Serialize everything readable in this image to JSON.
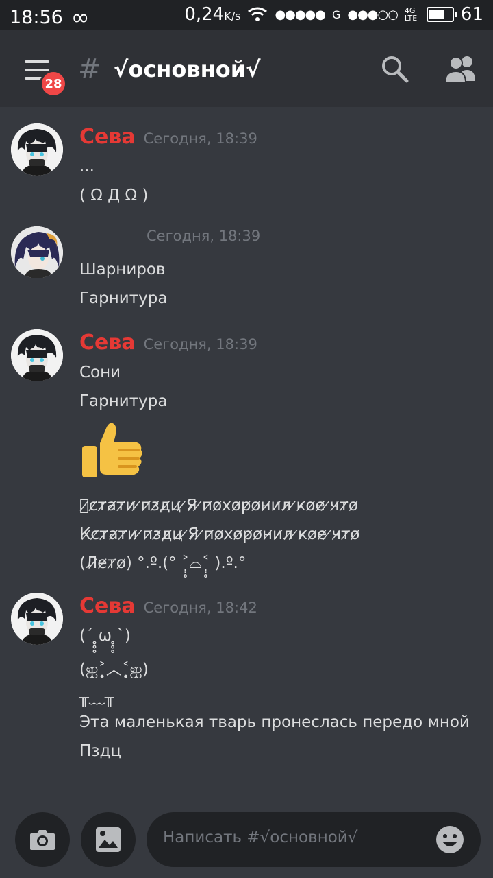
{
  "status_bar": {
    "time": "18:56",
    "loop_glyph": "∞",
    "speed": "0,24",
    "speed_unit": "K/s",
    "signal1": "●●●●●",
    "net1": "G",
    "signal2": "●●●○○",
    "net2": "4G LTE",
    "battery": "61"
  },
  "header": {
    "unread_count": "28",
    "hash": "#",
    "channel_name": "√основной√"
  },
  "messages": [
    {
      "author": "Сева",
      "timestamp": "Сегодня, 18:39",
      "lines": [
        "...",
        "( Ω Д Ω )"
      ]
    },
    {
      "author": "",
      "timestamp": "Сегодня, 18:39",
      "lines": [
        "Шарниров",
        "Гарнитура"
      ]
    },
    {
      "author": "Сева",
      "timestamp": "Сегодня, 18:39",
      "lines": [
        "Сони",
        "Гарнитура"
      ],
      "emoji": "thumbs-up",
      "lines_after": [
        "Ｋ̷с̷т̷а̷т̷и̷ ̷п̷з̷д̷ц̷ ̷Я̷ ̷п̷о̷х̷о̷р̷о̷н̷и̷л̷ ̷к̷о̷е̷ ̷ч̷т̷о̷",
        "К̷с̷т̷а̷т̷и̷ ̷п̷з̷д̷ц̷ ̷Я̷ ̷п̷о̷х̷о̷р̷о̷н̷и̷л̷ ̷к̷о̷е̷ ̷ч̷т̷о̷",
        "(Л̷е̷т̷о̷) °.º.(° ˃̣̣̥⌓˂̣̣̥ ).º.°"
      ]
    },
    {
      "author": "Сева",
      "timestamp": "Сегодня, 18:42",
      "lines": [
        "(´ ̥̥̥ω ̥̥̥`)",
        "(ஐ˃̣̣̥︿˂̣̣̥ஐ)",
        "╥﹏╥",
        "Эта маленькая тварь пронеслась передо мной",
        "Пздц"
      ]
    }
  ],
  "composer": {
    "placeholder": "Написать #√основной√"
  },
  "icons": {
    "menu": "menu-icon",
    "search": "search-icon",
    "members": "members-icon",
    "camera": "camera-icon",
    "image": "image-icon",
    "emoji": "emoji-icon"
  },
  "colors": {
    "background": "#36393f",
    "header": "#2f3136",
    "author": "#e53935",
    "badge": "#f04747"
  }
}
